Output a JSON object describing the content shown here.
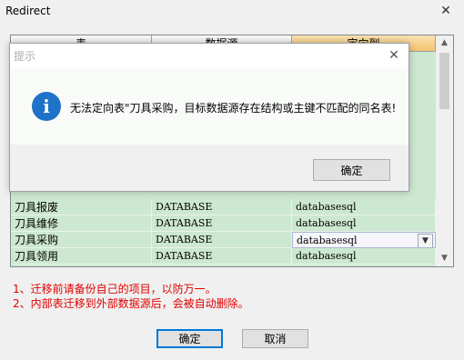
{
  "window": {
    "title": "Redirect",
    "close_glyph": "✕"
  },
  "grid": {
    "columns": [
      "表",
      "数据源",
      "定向到"
    ],
    "rows": [
      {
        "table": "刀具报废",
        "source": "DATABASE",
        "target": "databasesql"
      },
      {
        "table": "刀具维修",
        "source": "DATABASE",
        "target": "databasesql"
      },
      {
        "table": "刀具采购",
        "source": "DATABASE",
        "target": "databasesql"
      },
      {
        "table": "刀具领用",
        "source": "DATABASE",
        "target": "databasesql"
      }
    ]
  },
  "notes": [
    "1、迁移前请备份自己的项目，以防万一。",
    "2、内部表迁移到外部数据源后，会被自动删除。"
  ],
  "buttons": {
    "ok": "确定",
    "cancel": "取消"
  },
  "dialog": {
    "title": "提示",
    "icon_glyph": "i",
    "message": "无法定向表\"刀具采购，目标数据源存在结构或主键不匹配的同名表!",
    "ok": "确定",
    "close_glyph": "✕"
  },
  "colors": {
    "grid_bg": "#cde8d0",
    "header_selected": "#f3c36e",
    "note_text": "#e00000",
    "info_icon": "#1f72c8"
  }
}
